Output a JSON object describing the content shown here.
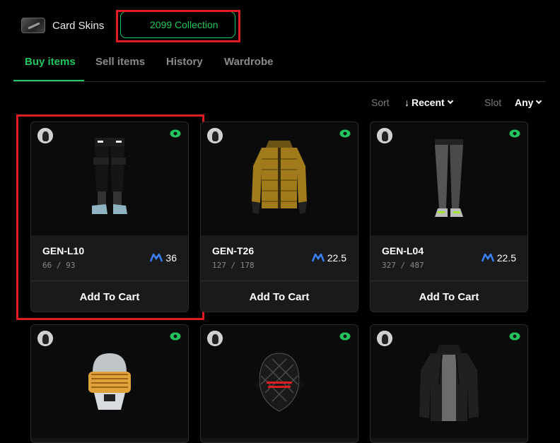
{
  "collections": [
    {
      "label": "Card Skins",
      "icon": "card-skin-icon"
    },
    {
      "label": "2099 Collection",
      "icon": "robot-avatar-icon",
      "active": true
    }
  ],
  "tabs": {
    "buy": "Buy items",
    "sell": "Sell items",
    "history": "History",
    "wardrobe": "Wardrobe",
    "active": "buy"
  },
  "filters": {
    "sort_label": "Sort",
    "sort_value": "Recent",
    "slot_label": "Slot",
    "slot_value": "Any"
  },
  "colors": {
    "accent": "#22c55e",
    "highlight": "#e11d24",
    "background": "#000000",
    "card": "#141414"
  },
  "items": [
    {
      "name": "GEN-L10",
      "count": "66 / 93",
      "price": "36",
      "cta": "Add To Cart",
      "kind": "pants-black"
    },
    {
      "name": "GEN-T26",
      "count": "127 / 178",
      "price": "22.5",
      "cta": "Add To Cart",
      "kind": "jacket-gold"
    },
    {
      "name": "GEN-L04",
      "count": "327 / 487",
      "price": "22.5",
      "cta": "Add To Cart",
      "kind": "leggings-gray"
    },
    {
      "kind": "helmet-gold"
    },
    {
      "kind": "mask-black"
    },
    {
      "kind": "jacket-black"
    }
  ]
}
